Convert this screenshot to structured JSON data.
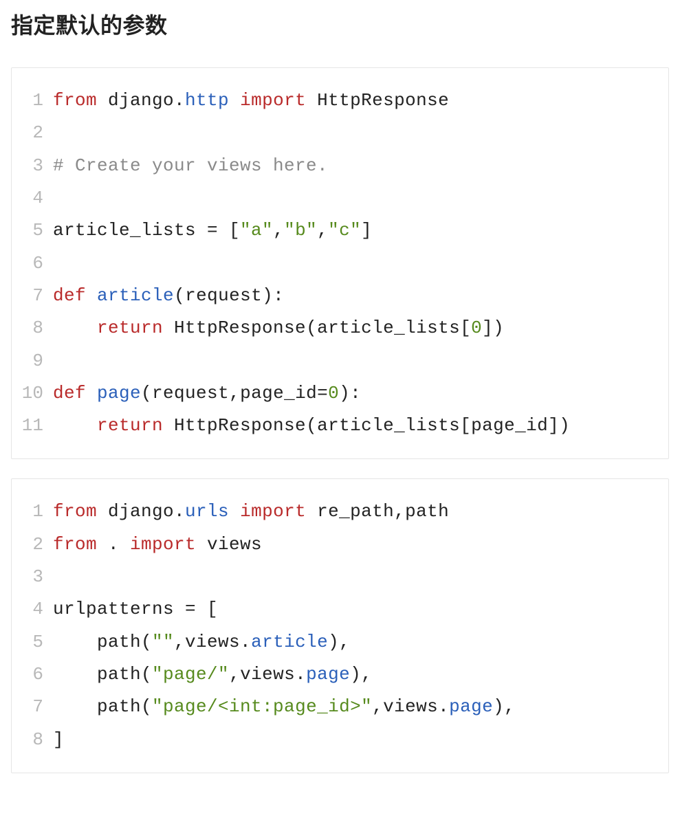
{
  "heading": "指定默认的参数",
  "blocks": [
    {
      "id": "block1",
      "lines": [
        [
          {
            "c": "kw",
            "t": "from"
          },
          {
            "c": "pl",
            "t": " django."
          },
          {
            "c": "mod",
            "t": "http"
          },
          {
            "c": "pl",
            "t": " "
          },
          {
            "c": "kw",
            "t": "import"
          },
          {
            "c": "pl",
            "t": " HttpResponse"
          }
        ],
        [],
        [
          {
            "c": "cmt",
            "t": "# Create your views here."
          }
        ],
        [],
        [
          {
            "c": "pl",
            "t": "article_lists = ["
          },
          {
            "c": "str",
            "t": "\"a\""
          },
          {
            "c": "pl",
            "t": ","
          },
          {
            "c": "str",
            "t": "\"b\""
          },
          {
            "c": "pl",
            "t": ","
          },
          {
            "c": "str",
            "t": "\"c\""
          },
          {
            "c": "pl",
            "t": "]"
          }
        ],
        [],
        [
          {
            "c": "kw",
            "t": "def"
          },
          {
            "c": "pl",
            "t": " "
          },
          {
            "c": "fn",
            "t": "article"
          },
          {
            "c": "pl",
            "t": "(request):"
          }
        ],
        [
          {
            "c": "pl",
            "t": "    "
          },
          {
            "c": "kw",
            "t": "return"
          },
          {
            "c": "pl",
            "t": " HttpResponse(article_lists["
          },
          {
            "c": "num",
            "t": "0"
          },
          {
            "c": "pl",
            "t": "])"
          }
        ],
        [],
        [
          {
            "c": "kw",
            "t": "def"
          },
          {
            "c": "pl",
            "t": " "
          },
          {
            "c": "fn",
            "t": "page"
          },
          {
            "c": "pl",
            "t": "(request,page_id="
          },
          {
            "c": "num",
            "t": "0"
          },
          {
            "c": "pl",
            "t": "):"
          }
        ],
        [
          {
            "c": "pl",
            "t": "    "
          },
          {
            "c": "kw",
            "t": "return"
          },
          {
            "c": "pl",
            "t": " HttpResponse(article_lists[page_id])"
          }
        ]
      ]
    },
    {
      "id": "block2",
      "lines": [
        [
          {
            "c": "kw",
            "t": "from"
          },
          {
            "c": "pl",
            "t": " django."
          },
          {
            "c": "mod",
            "t": "urls"
          },
          {
            "c": "pl",
            "t": " "
          },
          {
            "c": "kw",
            "t": "import"
          },
          {
            "c": "pl",
            "t": " re_path,path"
          }
        ],
        [
          {
            "c": "kw",
            "t": "from"
          },
          {
            "c": "pl",
            "t": " . "
          },
          {
            "c": "kw",
            "t": "import"
          },
          {
            "c": "pl",
            "t": " views"
          }
        ],
        [],
        [
          {
            "c": "pl",
            "t": "urlpatterns = ["
          }
        ],
        [
          {
            "c": "pl",
            "t": "    path("
          },
          {
            "c": "str",
            "t": "\"\""
          },
          {
            "c": "pl",
            "t": ",views."
          },
          {
            "c": "fn",
            "t": "article"
          },
          {
            "c": "pl",
            "t": "),"
          }
        ],
        [
          {
            "c": "pl",
            "t": "    path("
          },
          {
            "c": "str",
            "t": "\"page/\""
          },
          {
            "c": "pl",
            "t": ",views."
          },
          {
            "c": "fn",
            "t": "page"
          },
          {
            "c": "pl",
            "t": "),"
          }
        ],
        [
          {
            "c": "pl",
            "t": "    path("
          },
          {
            "c": "str",
            "t": "\"page/<int:page_id>\""
          },
          {
            "c": "pl",
            "t": ",views."
          },
          {
            "c": "fn",
            "t": "page"
          },
          {
            "c": "pl",
            "t": "),"
          }
        ],
        [
          {
            "c": "pl",
            "t": "]"
          }
        ]
      ]
    }
  ]
}
